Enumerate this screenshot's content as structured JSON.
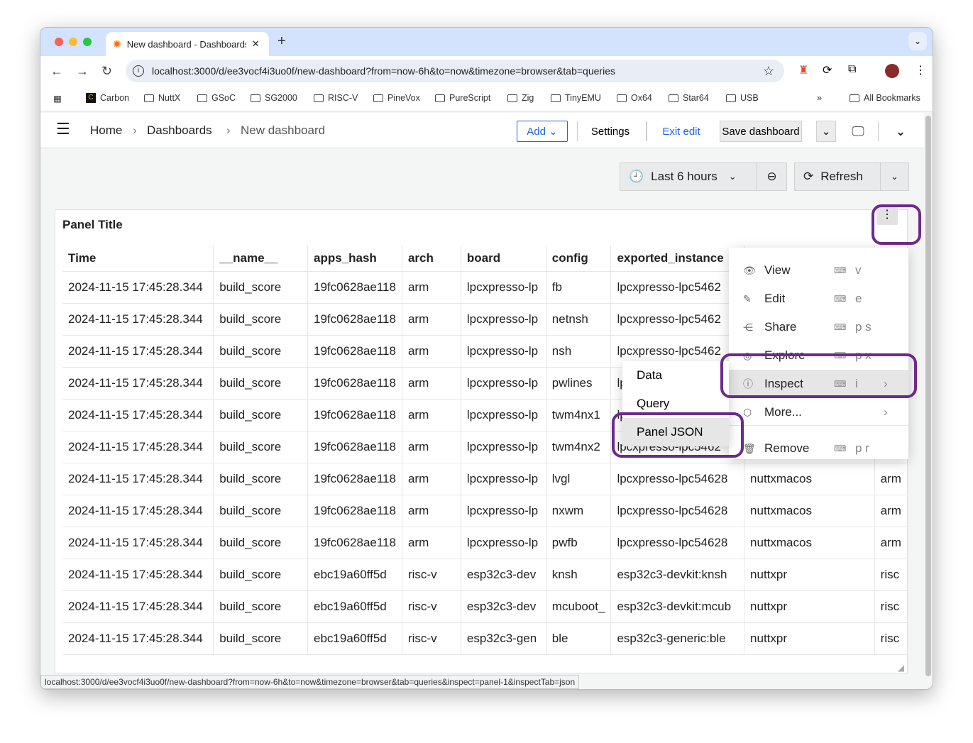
{
  "browser": {
    "tab_title": "New dashboard - Dashboards",
    "url": "localhost:3000/d/ee3vocf4i3uo0f/new-dashboard?from=now-6h&to=now&timezone=browser&tab=queries",
    "bookmarks": [
      "Carbon",
      "NuttX",
      "GSoC",
      "SG2000",
      "RISC-V",
      "PineVox",
      "PureScript",
      "Zig",
      "TinyEMU",
      "Ox64",
      "Star64",
      "USB"
    ],
    "more": "»",
    "all_bookmarks": "All Bookmarks",
    "status_url": "localhost:3000/d/ee3vocf4i3uo0f/new-dashboard?from=now-6h&to=now&timezone=browser&tab=queries&inspect=panel-1&inspectTab=json"
  },
  "header": {
    "breadcrumb": [
      "Home",
      "Dashboards",
      "New dashboard"
    ],
    "add": "Add",
    "settings": "Settings",
    "exit_edit": "Exit edit",
    "save": "Save dashboard"
  },
  "toolbar": {
    "time_range": "Last 6 hours",
    "refresh": "Refresh"
  },
  "panel": {
    "title": "Panel Title",
    "columns": [
      "Time",
      "__name__",
      "apps_hash",
      "arch",
      "board",
      "config",
      "exported_instance",
      "",
      ""
    ],
    "rows": [
      [
        "2024-11-15 17:45:28.344",
        "build_score",
        "19fc0628ae118",
        "arm",
        "lpcxpresso-lp",
        "fb",
        "lpcxpresso-lpc5462",
        "",
        ""
      ],
      [
        "2024-11-15 17:45:28.344",
        "build_score",
        "19fc0628ae118",
        "arm",
        "lpcxpresso-lp",
        "netnsh",
        "lpcxpresso-lpc5462",
        "",
        ""
      ],
      [
        "2024-11-15 17:45:28.344",
        "build_score",
        "19fc0628ae118",
        "arm",
        "lpcxpresso-lp",
        "nsh",
        "lpcxpresso-lpc5462",
        "",
        ""
      ],
      [
        "2024-11-15 17:45:28.344",
        "build_score",
        "19fc0628ae118",
        "arm",
        "lpcxpresso-lp",
        "pwlines",
        "lp",
        "",
        ""
      ],
      [
        "2024-11-15 17:45:28.344",
        "build_score",
        "19fc0628ae118",
        "arm",
        "lpcxpresso-lp",
        "twm4nx1",
        "lp",
        "",
        ""
      ],
      [
        "2024-11-15 17:45:28.344",
        "build_score",
        "19fc0628ae118",
        "arm",
        "lpcxpresso-lp",
        "twm4nx2",
        "lpcxpresso-lpc5462",
        "",
        ""
      ],
      [
        "2024-11-15 17:45:28.344",
        "build_score",
        "19fc0628ae118",
        "arm",
        "lpcxpresso-lp",
        "lvgl",
        "lpcxpresso-lpc54628",
        "nuttxmacos",
        "arm"
      ],
      [
        "2024-11-15 17:45:28.344",
        "build_score",
        "19fc0628ae118",
        "arm",
        "lpcxpresso-lp",
        "nxwm",
        "lpcxpresso-lpc54628",
        "nuttxmacos",
        "arm"
      ],
      [
        "2024-11-15 17:45:28.344",
        "build_score",
        "19fc0628ae118",
        "arm",
        "lpcxpresso-lp",
        "pwfb",
        "lpcxpresso-lpc54628",
        "nuttxmacos",
        "arm"
      ],
      [
        "2024-11-15 17:45:28.344",
        "build_score",
        "ebc19a60ff5d",
        "risc-v",
        "esp32c3-dev",
        "knsh",
        "esp32c3-devkit:knsh",
        "nuttxpr",
        "risc"
      ],
      [
        "2024-11-15 17:45:28.344",
        "build_score",
        "ebc19a60ff5d",
        "risc-v",
        "esp32c3-dev",
        "mcuboot_",
        "esp32c3-devkit:mcub",
        "nuttxpr",
        "risc"
      ],
      [
        "2024-11-15 17:45:28.344",
        "build_score",
        "ebc19a60ff5d",
        "risc-v",
        "esp32c3-gen",
        "ble",
        "esp32c3-generic:ble",
        "nuttxpr",
        "risc"
      ]
    ]
  },
  "menu": {
    "items": [
      {
        "label": "View",
        "shortcut": "v"
      },
      {
        "label": "Edit",
        "shortcut": "e"
      },
      {
        "label": "Share",
        "shortcut": "p s"
      },
      {
        "label": "Explore",
        "shortcut": "p x"
      },
      {
        "label": "Inspect",
        "shortcut": "i"
      },
      {
        "label": "More...",
        "shortcut": ""
      },
      {
        "label": "Remove",
        "shortcut": "p r"
      }
    ],
    "submenu": [
      "Data",
      "Query",
      "Panel JSON"
    ]
  },
  "colors": {
    "highlight": "#6c2a8c",
    "link": "#1f62e0"
  }
}
